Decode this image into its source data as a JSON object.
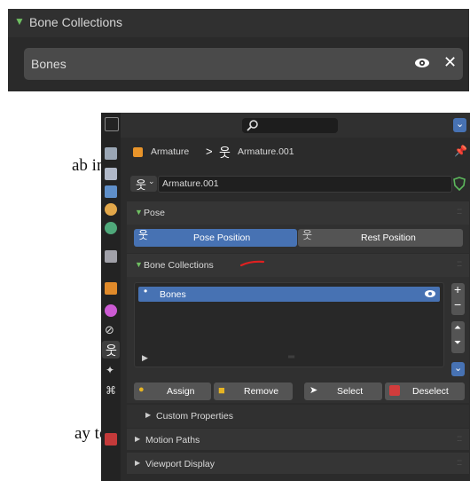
{
  "top": {
    "header": "Bone Collections",
    "row_label": "Bones"
  },
  "fragments": {
    "f1": "ab in",
    "f2": "ay to"
  },
  "panel": {
    "breadcrumb_root": "Armature",
    "breadcrumb_sep": ">",
    "breadcrumb_child": "Armature.001",
    "datablock_name": "Armature.001",
    "pose_section": "Pose",
    "pose_position_label": "Pose Position",
    "rest_position_label": "Rest Position",
    "bone_collections_section": "Bone Collections",
    "list_item": "Bones",
    "assign_label": "Assign",
    "remove_label": "Remove",
    "select_label": "Select",
    "deselect_label": "Deselect",
    "custom_props": "Custom Properties",
    "motion_paths": "Motion Paths",
    "viewport_display": "Viewport Display"
  },
  "colors": {
    "accent_blue": "#4772b3",
    "green_triangle": "#6fbf62",
    "annotation_red": "#e02020"
  },
  "icons": [
    "eye-icon",
    "close-icon",
    "search-icon",
    "armature-icon",
    "pin-icon",
    "shield-icon",
    "plus-icon",
    "minus-icon",
    "up-icon",
    "down-icon",
    "chevron-down-icon"
  ]
}
